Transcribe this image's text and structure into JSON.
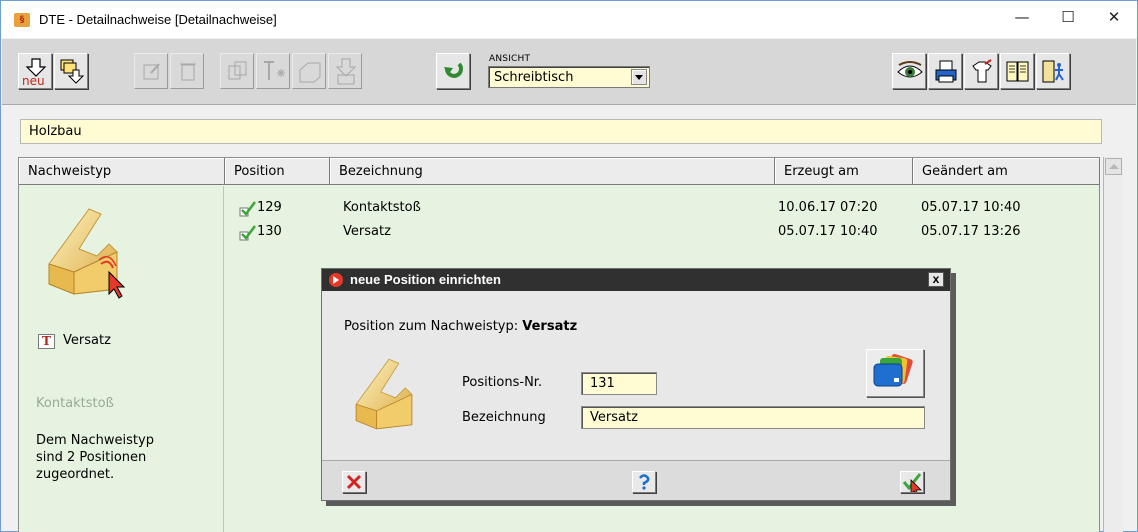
{
  "window": {
    "title": "DTE - Detailnachweise [Detailnachweise]",
    "title_icon_text": "§",
    "minimize": "—",
    "maximize": "☐",
    "close": "✕"
  },
  "toolbar": {
    "new_label": "neu",
    "ansicht_label": "ANSICHT",
    "ansicht_value": "Schreibtisch"
  },
  "path": "Holzbau",
  "table": {
    "headers": [
      "Nachweistyp",
      "Position",
      "Bezeichnung",
      "Erzeugt am",
      "Geändert am"
    ],
    "rows": [
      {
        "position": "129",
        "bezeichnung": "Kontaktstoß",
        "erzeugt": "10.06.17 07:20",
        "geaendert": "05.07.17 10:40"
      },
      {
        "position": "130",
        "bezeichnung": "Versatz",
        "erzeugt": "05.07.17 10:40",
        "geaendert": "05.07.17 13:26"
      }
    ]
  },
  "left_panel": {
    "t_icon": "T",
    "selected_type": "Versatz",
    "other_type": "Kontaktstoß",
    "info": "Dem Nachweistyp\nsind 2 Positionen\nzugeordnet."
  },
  "dialog": {
    "title": "neue Position einrichten",
    "close": "x",
    "heading_prefix": "Position zum Nachweistyp:",
    "heading_type": "Versatz",
    "positions_label": "Positions-Nr.",
    "positions_value": "131",
    "bezeichnung_label": "Bezeichnung",
    "bezeichnung_value": "Versatz"
  },
  "colors": {
    "table_bg": "#e7f3e1",
    "field_bg": "#fffbd2",
    "dialog_title_bg": "#303030",
    "accent_red": "#e53a2a",
    "check_green": "#3aa63a"
  }
}
